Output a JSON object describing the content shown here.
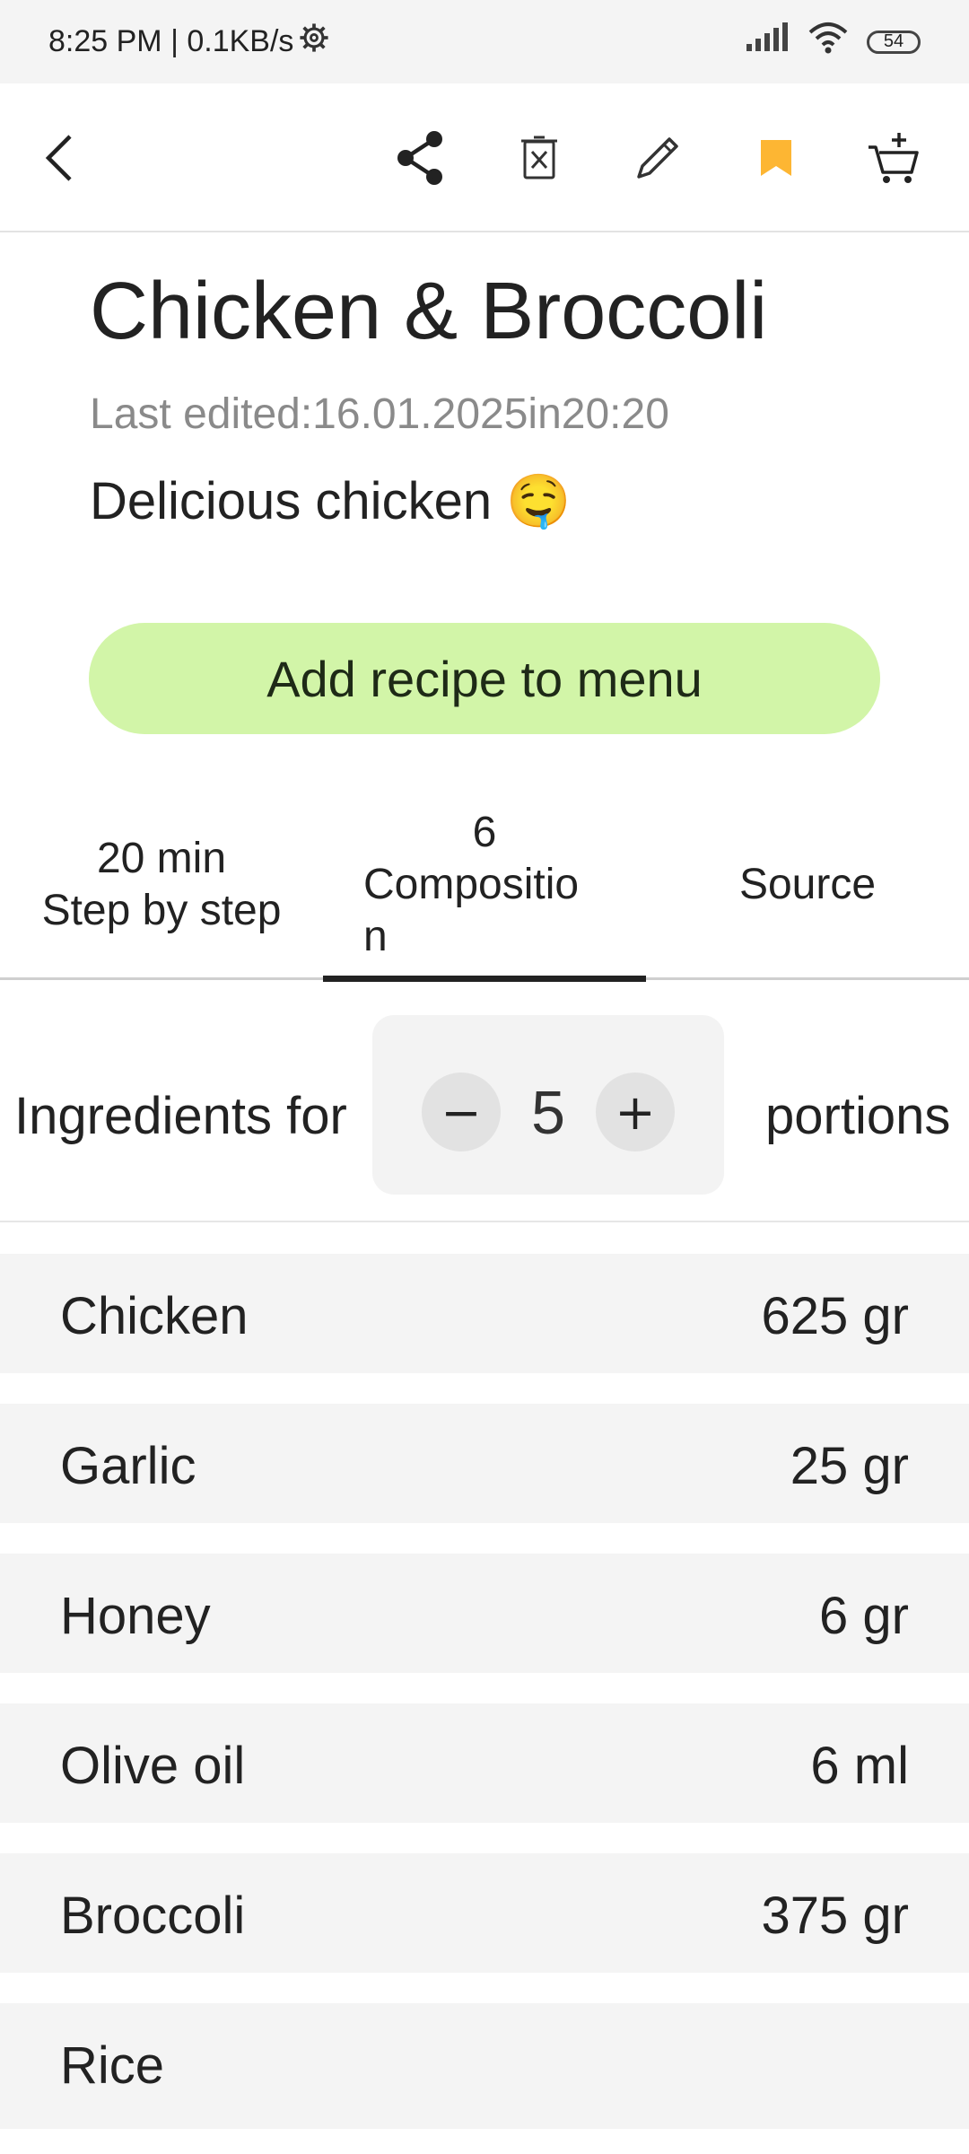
{
  "status_bar": {
    "time_speed": "8:25 PM | 0.1KB/s",
    "battery": "54",
    "icons": [
      "settings-gear-icon",
      "signal-icon",
      "wifi-icon",
      "battery-icon"
    ]
  },
  "toolbar": {
    "icons": [
      "back-icon",
      "share-icon",
      "delete-icon",
      "edit-icon",
      "bookmark-icon",
      "add-to-cart-icon"
    ],
    "bookmark_color": "#FDB633"
  },
  "recipe": {
    "title": "Chicken & Broccoli",
    "last_edited": "Last edited:16.01.2025in20:20",
    "description": "Delicious chicken 🤤"
  },
  "add_button": {
    "label": "Add recipe to menu",
    "color": "#D2F5A8"
  },
  "tabs": [
    {
      "top": "20 min",
      "label": "Step by step"
    },
    {
      "top": "6",
      "label": "Compositio\nn",
      "active": true
    },
    {
      "top": "",
      "label": "Source"
    }
  ],
  "portions": {
    "label": "Ingredients for",
    "value": "5",
    "suffix": "portions",
    "minus": "−",
    "plus": "+"
  },
  "ingredients": [
    {
      "name": "Chicken",
      "qty": "625 gr"
    },
    {
      "name": "Garlic",
      "qty": "25 gr"
    },
    {
      "name": "Honey",
      "qty": "6 gr"
    },
    {
      "name": "Olive oil",
      "qty": "6 ml"
    },
    {
      "name": "Broccoli",
      "qty": "375 gr"
    },
    {
      "name": "Rice",
      "qty": ""
    }
  ]
}
